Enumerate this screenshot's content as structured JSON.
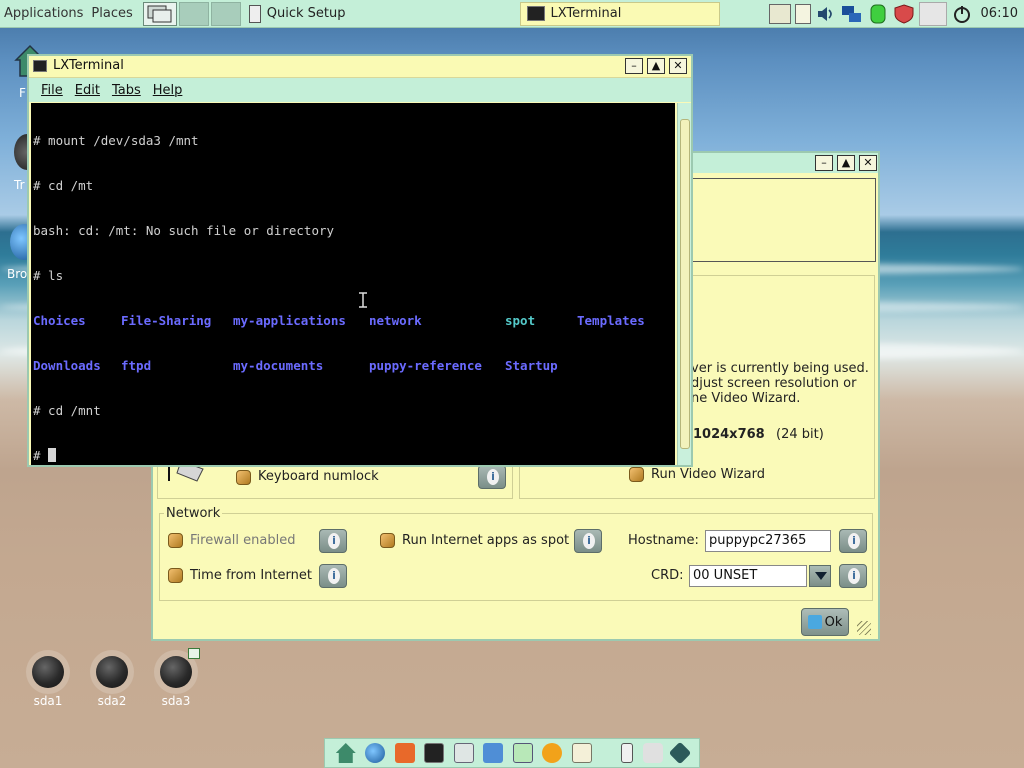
{
  "top_panel": {
    "applications": "Applications",
    "places": "Places",
    "tasks": [
      {
        "label": "Quick Setup",
        "icon": "wrench-icon"
      },
      {
        "label": "LXTerminal",
        "icon": "terminal-icon",
        "active": true
      }
    ],
    "clock": "06:10"
  },
  "desktop": {
    "partial_labels": [
      "F",
      "Tr",
      "Bro"
    ],
    "drives": [
      "sda1",
      "sda2",
      "sda3"
    ]
  },
  "dialog": {
    "text_lines": [
      "ver is currently being used.",
      "djust screen resolution or",
      "ne Video Wizard."
    ],
    "resolution": "1024x768",
    "bit_depth": "(24 bit)",
    "keyboard_numlock": "Keyboard numlock",
    "run_video_wizard": "Run Video Wizard",
    "network_title": "Network",
    "firewall": "Firewall enabled",
    "run_internet_spot": "Run Internet apps as spot",
    "hostname_label": "Hostname:",
    "hostname_value": "puppypc27365",
    "time_from_internet": "Time from Internet",
    "crd_label": "CRD:",
    "crd_value": "00 UNSET",
    "ok": "Ok"
  },
  "terminal": {
    "title": "LXTerminal",
    "menu": [
      "File",
      "Edit",
      "Tabs",
      "Help"
    ],
    "lines": [
      "# mount /dev/sda3 /mnt",
      "# cd /mt",
      "bash: cd: /mt: No such file or directory",
      "# ls"
    ],
    "ls_row1": [
      "Choices",
      "File-Sharing",
      "my-applications",
      "network",
      "spot",
      "Templates"
    ],
    "ls_row2": [
      "Downloads",
      "ftpd",
      "my-documents",
      "puppy-reference",
      "Startup"
    ],
    "after": [
      "# cd /mnt"
    ],
    "prompt": "# "
  },
  "colors": {
    "panel": "#c4efd8",
    "window_yellow": "#fafab8",
    "ls_dir": "#6b6bff",
    "ls_exec": "#54c9c9"
  }
}
